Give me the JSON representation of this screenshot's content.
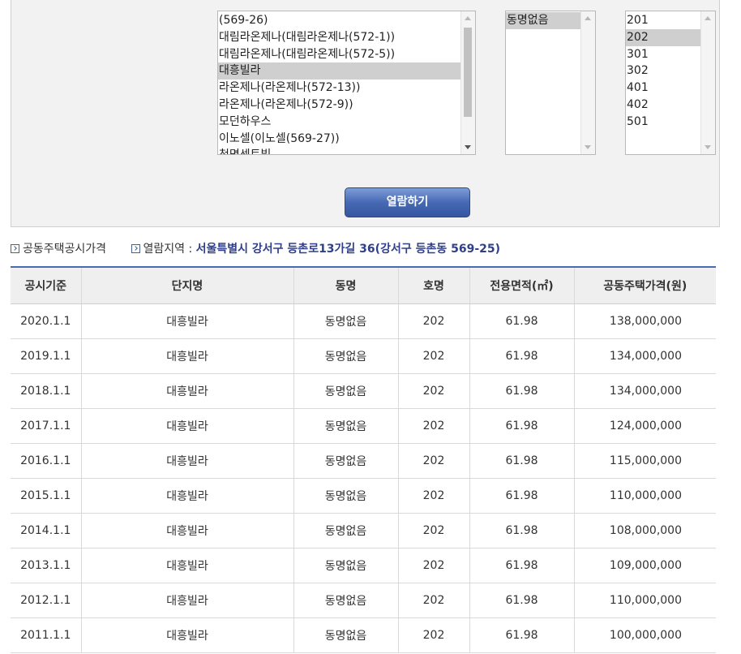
{
  "selectors": {
    "complex_list": {
      "options": [
        "(569-26)",
        "대림라온제나(대림라온제나(572-1))",
        "대림라온제나(대림라온제나(572-5))",
        "대흥빌라",
        "라온제나(라온제나(572-13))",
        "라온제나(라온제나(572-9))",
        "모던하우스",
        "이노셀(이노셀(569-27))",
        "청명센트빌"
      ],
      "selected": "대흥빌라"
    },
    "dong_list": {
      "options": [
        "동명없음"
      ],
      "selected": "동명없음"
    },
    "ho_list": {
      "options": [
        "201",
        "202",
        "301",
        "302",
        "401",
        "402",
        "501"
      ],
      "selected": "202"
    }
  },
  "view_button_label": "열람하기",
  "info": {
    "price_type_label": "공동주택공시가격",
    "region_label": "열람지역 :",
    "region_address": "서울특별시 강서구 등촌로13가길 36(강서구 등촌동 569-25)"
  },
  "table": {
    "headers": [
      "공시기준",
      "단지명",
      "동명",
      "호명",
      "전용면적(㎡)",
      "공동주택가격(원)"
    ],
    "rows": [
      [
        "2020.1.1",
        "대흥빌라",
        "동명없음",
        "202",
        "61.98",
        "138,000,000"
      ],
      [
        "2019.1.1",
        "대흥빌라",
        "동명없음",
        "202",
        "61.98",
        "134,000,000"
      ],
      [
        "2018.1.1",
        "대흥빌라",
        "동명없음",
        "202",
        "61.98",
        "134,000,000"
      ],
      [
        "2017.1.1",
        "대흥빌라",
        "동명없음",
        "202",
        "61.98",
        "124,000,000"
      ],
      [
        "2016.1.1",
        "대흥빌라",
        "동명없음",
        "202",
        "61.98",
        "115,000,000"
      ],
      [
        "2015.1.1",
        "대흥빌라",
        "동명없음",
        "202",
        "61.98",
        "110,000,000"
      ],
      [
        "2014.1.1",
        "대흥빌라",
        "동명없음",
        "202",
        "61.98",
        "108,000,000"
      ],
      [
        "2013.1.1",
        "대흥빌라",
        "동명없음",
        "202",
        "61.98",
        "109,000,000"
      ],
      [
        "2012.1.1",
        "대흥빌라",
        "동명없음",
        "202",
        "61.98",
        "110,000,000"
      ],
      [
        "2011.1.1",
        "대흥빌라",
        "동명없음",
        "202",
        "61.98",
        "100,000,000"
      ]
    ]
  },
  "colors": {
    "accent_blue": "#4a6bb0",
    "address_text": "#2f3f8a",
    "button_top": "#7d9dd7",
    "button_bottom": "#35559f"
  }
}
